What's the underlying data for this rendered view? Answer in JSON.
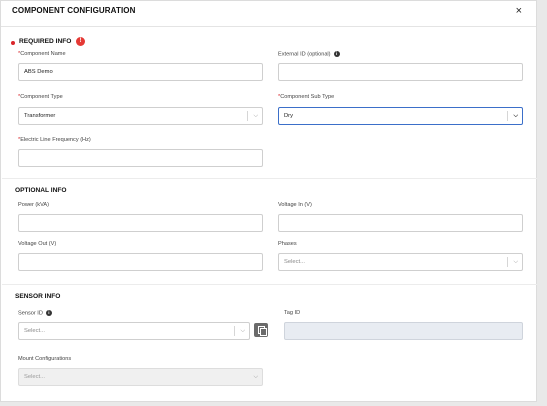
{
  "dialog": {
    "title": "COMPONENT CONFIGURATION",
    "close_label": "×"
  },
  "required_info": {
    "title": "REQUIRED INFO",
    "error_badge": "!",
    "component_name": {
      "label": "Component Name",
      "value": "ABS Demo"
    },
    "external_id": {
      "label": "External ID (optional)",
      "value": ""
    },
    "component_type": {
      "label": "Component Type",
      "value": "Transformer"
    },
    "component_sub_type": {
      "label": "Component Sub Type",
      "value": "Dry"
    },
    "line_frequency": {
      "label": "Electric Line Frequency (Hz)",
      "value": ""
    }
  },
  "optional_info": {
    "title": "OPTIONAL INFO",
    "power": {
      "label": "Power (kVA)",
      "value": ""
    },
    "voltage_in": {
      "label": "Voltage In (V)",
      "value": ""
    },
    "voltage_out": {
      "label": "Voltage Out (V)",
      "value": ""
    },
    "phases": {
      "label": "Phases",
      "placeholder": "Select..."
    }
  },
  "sensor_info": {
    "title": "SENSOR INFO",
    "sensor_id": {
      "label": "Sensor ID",
      "placeholder": "Select..."
    },
    "tag_id": {
      "label": "Tag ID",
      "value": ""
    },
    "mount_configurations": {
      "label": "Mount Configurations",
      "placeholder": "Select..."
    }
  },
  "required_marker": "*",
  "info_glyph": "i",
  "chevron_glyph": "⌵",
  "colors": {
    "required": "#d9262b",
    "focus_border": "#3b6fc9",
    "disabled_bg": "#e8ecf2"
  }
}
